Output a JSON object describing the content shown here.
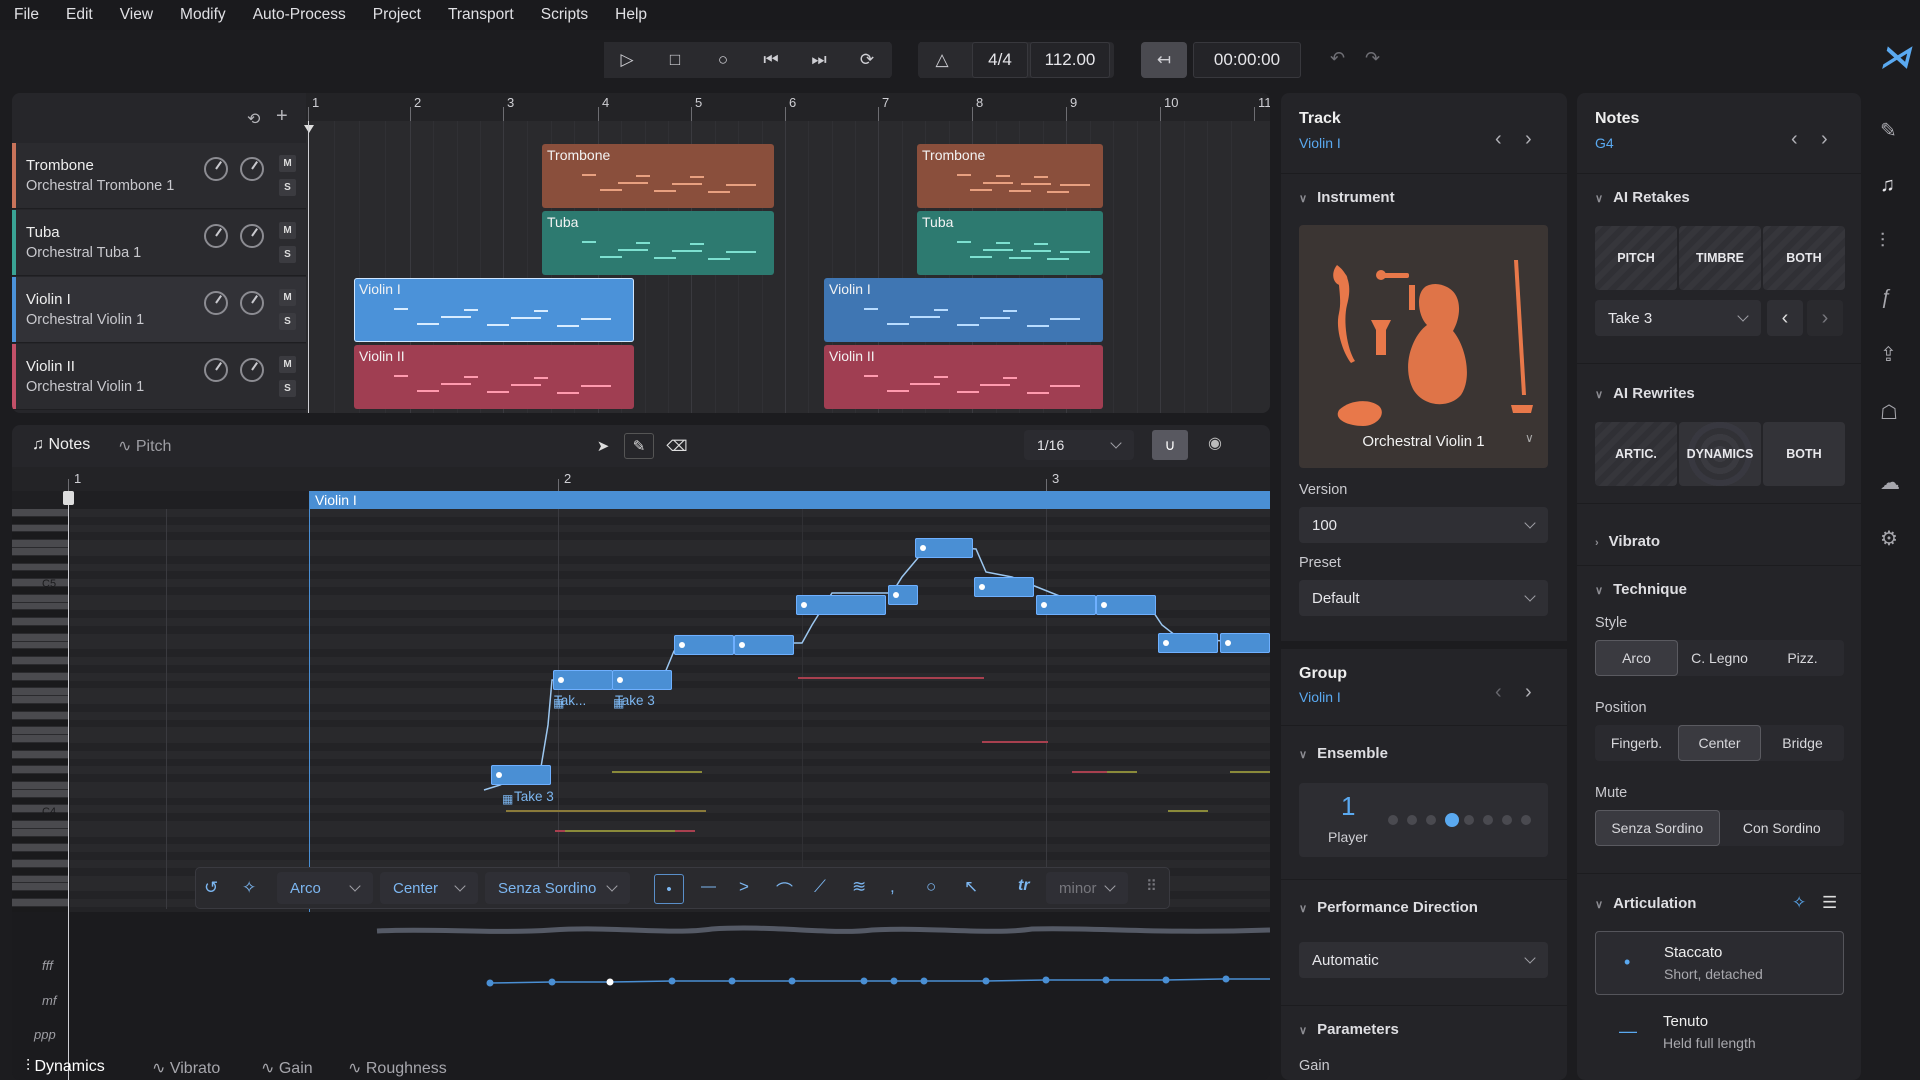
{
  "menu": [
    "File",
    "Edit",
    "View",
    "Modify",
    "Auto-Process",
    "Project",
    "Transport",
    "Scripts",
    "Help"
  ],
  "transport": {
    "time_signature": "4/4",
    "tempo": "112.00",
    "time": "00:00:00"
  },
  "ruler": [
    "1",
    "2",
    "3",
    "4",
    "5",
    "6",
    "7",
    "8",
    "9",
    "10",
    "11"
  ],
  "tracks": [
    {
      "name": "Trombone",
      "instrument": "Orchestral Trombone 1",
      "color": "#c8735a"
    },
    {
      "name": "Tuba",
      "instrument": "Orchestral Tuba 1",
      "color": "#3aa394"
    },
    {
      "name": "Violin I",
      "instrument": "Orchestral Violin 1",
      "color": "#4b92d9"
    },
    {
      "name": "Violin II",
      "instrument": "Orchestral Violin 1",
      "color": "#c25068"
    }
  ],
  "track_buttons": {
    "mute": "M",
    "solo": "S"
  },
  "clips": [
    {
      "label": "Trombone"
    },
    {
      "label": "Trombone"
    },
    {
      "label": "Tuba"
    },
    {
      "label": "Tuba"
    },
    {
      "label": "Violin I"
    },
    {
      "label": "Violin I"
    },
    {
      "label": "Violin II"
    },
    {
      "label": "Violin II"
    }
  ],
  "editor": {
    "tabs": [
      "Notes",
      "Pitch"
    ],
    "grid": "1/16",
    "ruler": [
      "1",
      "2",
      "3"
    ],
    "region_label": "Violin I",
    "pitch_labels": [
      "C5",
      "C4"
    ],
    "take_labels": [
      "Take 3",
      "Tak...",
      "Take 3"
    ],
    "dyn_labels": [
      "fff",
      "mf",
      "ppp"
    ],
    "bottom_tabs": [
      "Dynamics",
      "Vibrato",
      "Gain",
      "Roughness"
    ]
  },
  "float_toolbar": {
    "style": "Arco",
    "position": "Center",
    "mute": "Senza Sordino",
    "scale": "minor"
  },
  "track_inspector": {
    "title": "Track",
    "subtitle": "Violin I",
    "instrument_header": "Instrument",
    "instrument_name": "Orchestral Violin 1",
    "version_label": "Version",
    "version": "100",
    "preset_label": "Preset",
    "preset": "Default",
    "group_title": "Group",
    "group_subtitle": "Violin I",
    "ensemble_header": "Ensemble",
    "players": "1",
    "players_label": "Player",
    "perf_header": "Performance Direction",
    "perf_value": "Automatic",
    "params_header": "Parameters",
    "gain_label": "Gain"
  },
  "notes_inspector": {
    "title": "Notes",
    "subtitle": "G4",
    "retakes_header": "AI Retakes",
    "retakes": [
      "PITCH",
      "TIMBRE",
      "BOTH"
    ],
    "take": "Take 3",
    "rewrites_header": "AI Rewrites",
    "rewrites": [
      "ARTIC.",
      "DYNAMICS",
      "BOTH"
    ],
    "vibrato_header": "Vibrato",
    "technique_header": "Technique",
    "style_label": "Style",
    "styles": [
      "Arco",
      "C. Legno",
      "Pizz."
    ],
    "position_label": "Position",
    "positions": [
      "Fingerb.",
      "Center",
      "Bridge"
    ],
    "mute_label": "Mute",
    "mutes": [
      "Senza Sordino",
      "Con Sordino"
    ],
    "artic_header": "Articulation",
    "articulations": [
      {
        "name": "Staccato",
        "desc": "Short, detached"
      },
      {
        "name": "Tenuto",
        "desc": "Held full length"
      }
    ]
  },
  "colors": {
    "accent": "#4a8fd4",
    "trombone": "#8a4f3c",
    "tuba": "#2d7a70",
    "violin1": "#4b92d9",
    "violin2": "#a03e52"
  }
}
